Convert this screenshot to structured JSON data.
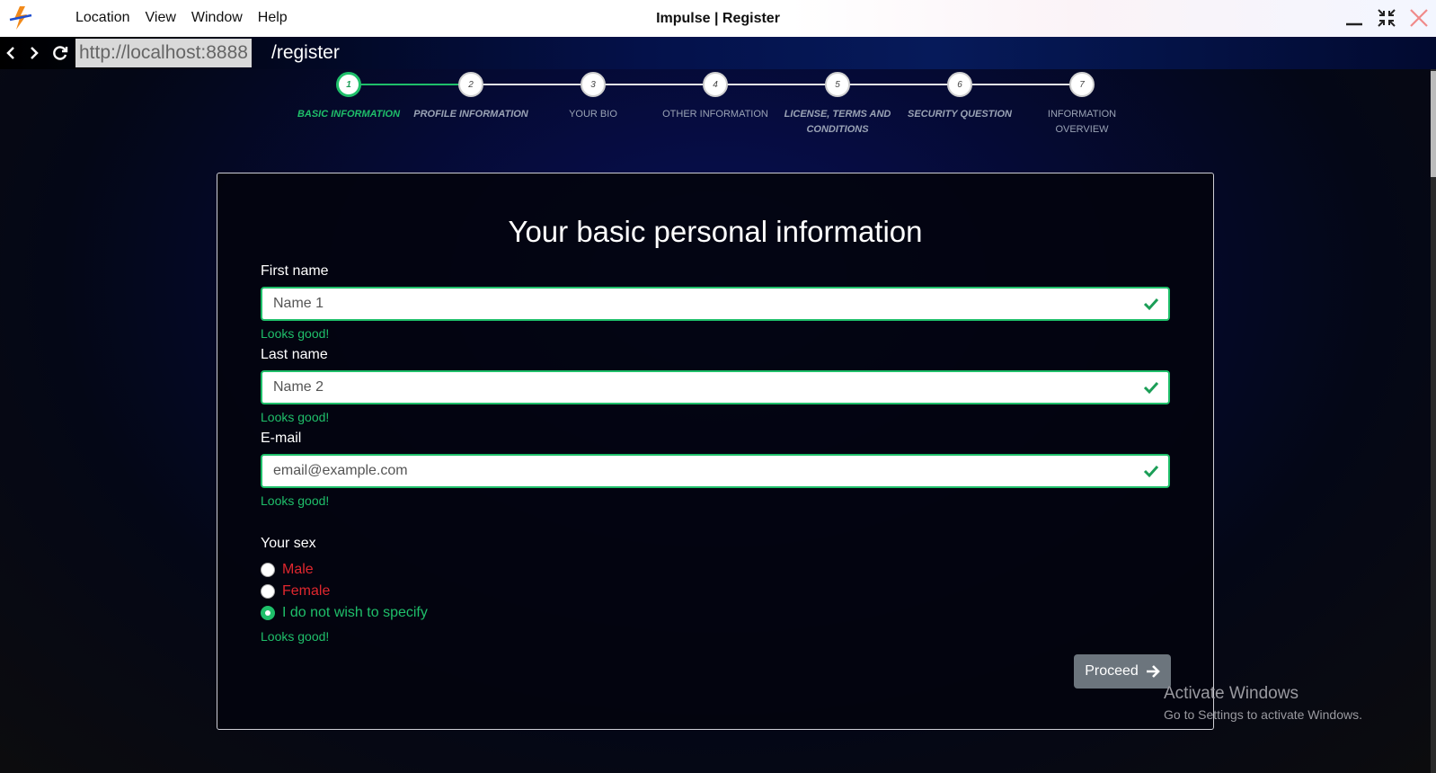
{
  "app": {
    "window_title": "Impulse | Register",
    "menu": [
      "Location",
      "View",
      "Window",
      "Help"
    ]
  },
  "address_bar": {
    "host": "http://localhost:8888",
    "path": "/register"
  },
  "stepper": {
    "steps": [
      {
        "number": "1",
        "label": "BASIC INFORMATION",
        "state": "active"
      },
      {
        "number": "2",
        "label": "PROFILE INFORMATION",
        "state": "pending"
      },
      {
        "number": "3",
        "label": "YOUR BIO",
        "state": "pending"
      },
      {
        "number": "4",
        "label": "OTHER INFORMATION",
        "state": "pending"
      },
      {
        "number": "5",
        "label": "LICENSE, TERMS AND CONDITIONS",
        "state": "pending"
      },
      {
        "number": "6",
        "label": "SECURITY QUESTION",
        "state": "pending"
      },
      {
        "number": "7",
        "label": "INFORMATION OVERVIEW",
        "state": "pending"
      }
    ]
  },
  "form": {
    "title": "Your basic personal information",
    "first_name": {
      "label": "First name",
      "value": "Name 1",
      "feedback": "Looks good!"
    },
    "last_name": {
      "label": "Last name",
      "value": "Name 2",
      "feedback": "Looks good!"
    },
    "email": {
      "label": "E-mail",
      "value": "email@example.com",
      "feedback": "Looks good!"
    },
    "sex": {
      "label": "Your sex",
      "options": [
        "Male",
        "Female",
        "I do not wish to specify"
      ],
      "selected": "I do not wish to specify",
      "feedback": "Looks good!"
    },
    "proceed_label": "Proceed"
  },
  "watermark": {
    "line1": "Activate Windows",
    "line2": "Go to Settings to activate Windows."
  },
  "colors": {
    "valid": "#1fbf6a",
    "invalid": "#e0272e",
    "button": "#6c757d"
  }
}
